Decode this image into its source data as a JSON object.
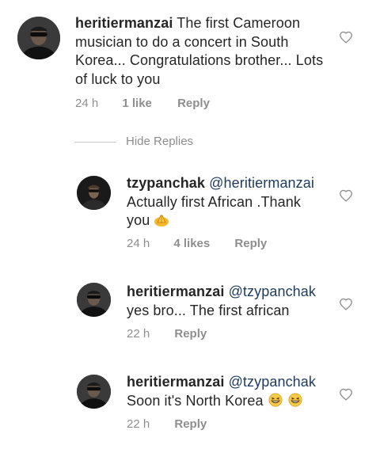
{
  "comments": [
    {
      "username": "heritiermanzai",
      "mention": "",
      "text": "The first Cameroon musician to do a concert in South Korea... Congratulations brother... Lots of luck to you",
      "time": "24 h",
      "likes": "1 like",
      "reply": "Reply",
      "avatar_icon": "profile-photo"
    },
    {
      "username": "tzypanchak",
      "mention": "@heritiermanzai",
      "text_line1": "Actually first African .Thank",
      "text_line2": "you",
      "text_emoji": "folded-hands-emoji",
      "time": "24 h",
      "likes": "4 likes",
      "reply": "Reply",
      "avatar_icon": "profile-photo"
    },
    {
      "username": "heritiermanzai",
      "mention": "@tzypanchak",
      "text": "yes bro... The first african",
      "time": "22 h",
      "reply": "Reply",
      "avatar_icon": "profile-photo"
    },
    {
      "username": "heritiermanzai",
      "mention": "@tzypanchak",
      "text": "Soon it's North Korea",
      "text_emoji": "grinning-squinting-face-emoji",
      "time": "22 h",
      "reply": "Reply",
      "avatar_icon": "profile-photo"
    }
  ],
  "hide_replies": "Hide Replies",
  "icons": {
    "like": "heart-outline-icon"
  },
  "colors": {
    "mention": "#1e3a5f",
    "meta": "#8e8e8e",
    "text": "#262626"
  }
}
